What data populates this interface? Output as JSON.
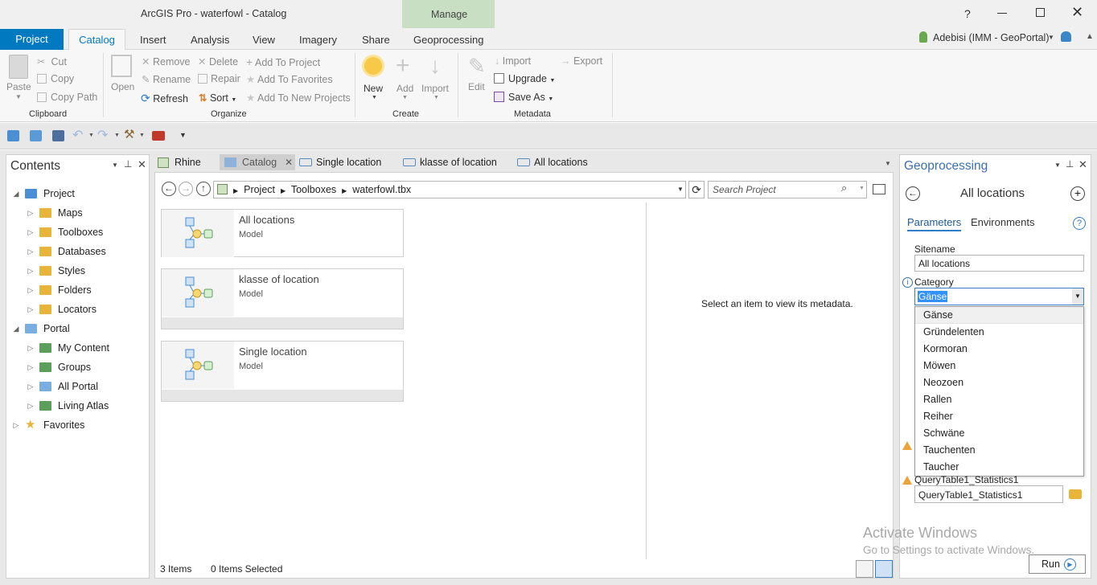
{
  "window": {
    "title": "ArcGIS Pro - waterfowl - Catalog",
    "manage_label": "Manage",
    "user": "Adebisi (IMM - GeoPortal)",
    "help": "?"
  },
  "ribbon": {
    "tabs": [
      {
        "label": "Project"
      },
      {
        "label": "Catalog"
      },
      {
        "label": "Insert"
      },
      {
        "label": "Analysis"
      },
      {
        "label": "View"
      },
      {
        "label": "Imagery"
      },
      {
        "label": "Share"
      },
      {
        "label": "Geoprocessing"
      }
    ],
    "clipboard": {
      "paste": "Paste",
      "cut": "Cut",
      "copy": "Copy",
      "copy_path": "Copy Path",
      "label": "Clipboard"
    },
    "organize": {
      "open": "Open",
      "remove": "Remove",
      "rename": "Rename",
      "refresh": "Refresh",
      "delete": "Delete",
      "repair": "Repair",
      "sort": "Sort",
      "add_to_project": "Add To Project",
      "add_to_favorites": "Add To Favorites",
      "add_to_new_projects": "Add To New Projects",
      "label": "Organize"
    },
    "create": {
      "new": "New",
      "add": "Add",
      "import": "Import",
      "label": "Create"
    },
    "metadata": {
      "edit": "Edit",
      "import": "Import",
      "upgrade": "Upgrade",
      "save_as": "Save As",
      "export": "Export",
      "label": "Metadata"
    }
  },
  "contents": {
    "title": "Contents",
    "items": [
      {
        "label": "Project",
        "level": 0
      },
      {
        "label": "Maps",
        "level": 1
      },
      {
        "label": "Toolboxes",
        "level": 1
      },
      {
        "label": "Databases",
        "level": 1
      },
      {
        "label": "Styles",
        "level": 1
      },
      {
        "label": "Folders",
        "level": 1
      },
      {
        "label": "Locators",
        "level": 1
      },
      {
        "label": "Portal",
        "level": 0
      },
      {
        "label": "My Content",
        "level": 1
      },
      {
        "label": "Groups",
        "level": 1
      },
      {
        "label": "All Portal",
        "level": 1
      },
      {
        "label": "Living Atlas",
        "level": 1
      },
      {
        "label": "Favorites",
        "level": 0
      }
    ]
  },
  "view_tabs": [
    {
      "label": "Rhine"
    },
    {
      "label": "Catalog"
    },
    {
      "label": "Single location"
    },
    {
      "label": "klasse of location"
    },
    {
      "label": "All locations"
    }
  ],
  "catalog": {
    "breadcrumb": [
      "Project",
      "Toolboxes",
      "waterfowl.tbx"
    ],
    "search_placeholder": "Search Project",
    "items": [
      {
        "name": "All locations",
        "type": "Model"
      },
      {
        "name": "klasse of location",
        "type": "Model"
      },
      {
        "name": "Single location",
        "type": "Model"
      }
    ],
    "metadata_hint": "Select an item to view its metadata.",
    "status_count": "3 Items",
    "status_selected": "0 Items Selected"
  },
  "geoprocessing": {
    "title": "Geoprocessing",
    "tool_name": "All locations",
    "tabs": {
      "parameters": "Parameters",
      "environments": "Environments"
    },
    "sitename_label": "Sitename",
    "sitename_value": "All locations",
    "category_label": "Category",
    "category_value": "Gänse",
    "category_options": [
      "Gänse",
      "Gründelenten",
      "Kormoran",
      "Möwen",
      "Neozoen",
      "Rallen",
      "Reiher",
      "Schwäne",
      "Tauchenten",
      "Taucher"
    ],
    "output_label": "QueryTable1_Statistics1",
    "output_value": "QueryTable1_Statistics1",
    "run": "Run"
  },
  "watermark": {
    "line1": "Activate Windows",
    "line2": "Go to Settings to activate Windows."
  },
  "colors": {
    "accent": "#0079c1",
    "manage": "#c8dfc4",
    "project_tab": "#0079c1"
  }
}
